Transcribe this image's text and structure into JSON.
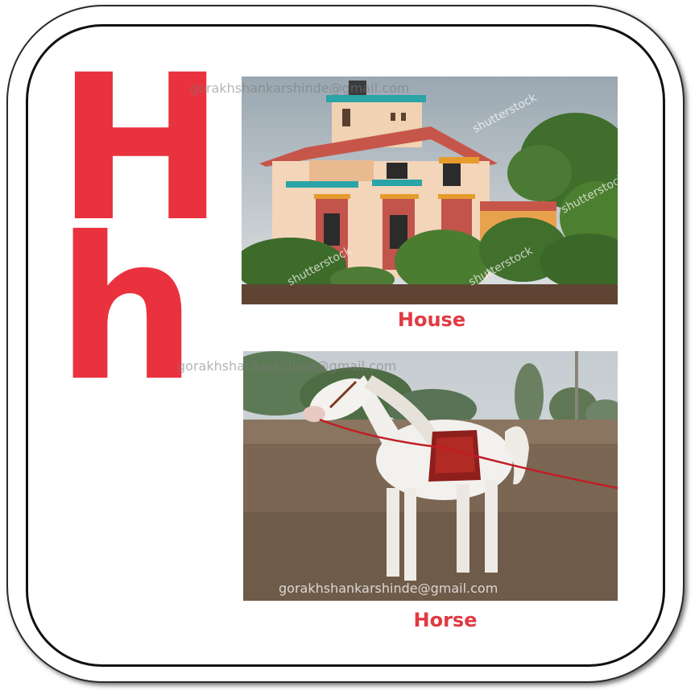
{
  "letters": {
    "upper": "H",
    "lower": "h"
  },
  "items": [
    {
      "word": "House",
      "image": "house-photo"
    },
    {
      "word": "Horse",
      "image": "horse-photo"
    }
  ],
  "watermarks": {
    "email": "gorakhshankarshinde@gmail.com",
    "stock": "shutterstock"
  },
  "colors": {
    "letter": "#ea323f",
    "caption": "#e03a42"
  }
}
